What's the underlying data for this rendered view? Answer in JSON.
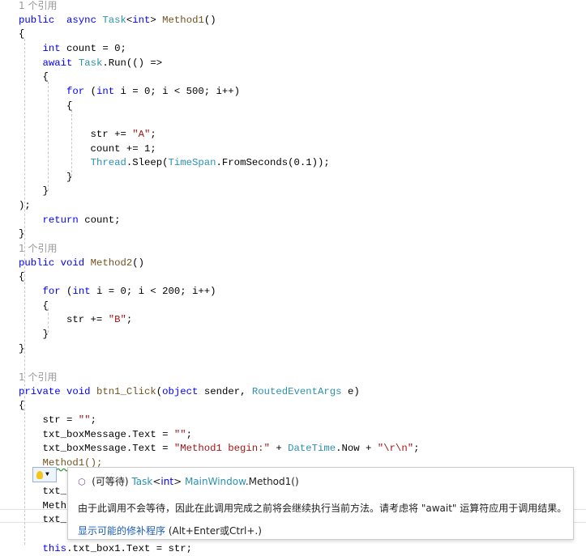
{
  "code_lines": [
    [
      [
        "1 个引用",
        "cm"
      ]
    ],
    [
      [
        "public",
        "kw"
      ],
      [
        "  ",
        ""
      ],
      [
        "async",
        "kw"
      ],
      [
        " ",
        ""
      ],
      [
        "Task",
        "ty"
      ],
      [
        "<",
        ""
      ],
      [
        "int",
        "kw"
      ],
      [
        "> ",
        ""
      ],
      [
        "Method1",
        "mt"
      ],
      [
        "()",
        ""
      ]
    ],
    [
      [
        "{",
        ""
      ]
    ],
    [
      [
        "    ",
        ""
      ],
      [
        "int",
        "kw"
      ],
      [
        " count = 0;",
        ""
      ]
    ],
    [
      [
        "    ",
        ""
      ],
      [
        "await",
        "kw"
      ],
      [
        " ",
        ""
      ],
      [
        "Task",
        "ty"
      ],
      [
        ".Run(() =>",
        ""
      ]
    ],
    [
      [
        "    {",
        ""
      ]
    ],
    [
      [
        "        ",
        ""
      ],
      [
        "for",
        "kw"
      ],
      [
        " (",
        ""
      ],
      [
        "int",
        "kw"
      ],
      [
        " i = 0; i < 500; i++)",
        ""
      ]
    ],
    [
      [
        "        {",
        ""
      ]
    ],
    [],
    [
      [
        "            str += ",
        ""
      ],
      [
        "\"A\"",
        "st"
      ],
      [
        ";",
        ""
      ]
    ],
    [
      [
        "            count += 1;",
        ""
      ]
    ],
    [
      [
        "            ",
        ""
      ],
      [
        "Thread",
        "ty"
      ],
      [
        ".Sleep(",
        ""
      ],
      [
        "TimeSpan",
        "ty"
      ],
      [
        ".FromSeconds(0.1));",
        ""
      ]
    ],
    [
      [
        "        }",
        ""
      ]
    ],
    [
      [
        "    }",
        ""
      ]
    ],
    [
      [
        ");",
        ""
      ]
    ],
    [
      [
        "    ",
        ""
      ],
      [
        "return",
        "kw"
      ],
      [
        " count;",
        ""
      ]
    ],
    [
      [
        "}",
        ""
      ]
    ],
    [
      [
        "1 个引用",
        "cm"
      ]
    ],
    [
      [
        "public",
        "kw"
      ],
      [
        " ",
        ""
      ],
      [
        "void",
        "kw"
      ],
      [
        " ",
        ""
      ],
      [
        "Method2",
        "mt"
      ],
      [
        "()",
        ""
      ]
    ],
    [
      [
        "{",
        ""
      ]
    ],
    [
      [
        "    ",
        ""
      ],
      [
        "for",
        "kw"
      ],
      [
        " (",
        ""
      ],
      [
        "int",
        "kw"
      ],
      [
        " i = 0; i < 200; i++)",
        ""
      ]
    ],
    [
      [
        "    {",
        ""
      ]
    ],
    [
      [
        "        str += ",
        ""
      ],
      [
        "\"B\"",
        "st"
      ],
      [
        ";",
        ""
      ]
    ],
    [
      [
        "    }",
        ""
      ]
    ],
    [
      [
        "}",
        ""
      ]
    ],
    [],
    [
      [
        "1 个引用",
        "cm"
      ]
    ],
    [
      [
        "private",
        "kw"
      ],
      [
        " ",
        ""
      ],
      [
        "void",
        "kw"
      ],
      [
        " ",
        ""
      ],
      [
        "btn1_Click",
        "mt"
      ],
      [
        "(",
        ""
      ],
      [
        "object",
        "kw"
      ],
      [
        " sender, ",
        ""
      ],
      [
        "RoutedEventArgs",
        "ty"
      ],
      [
        " e)",
        ""
      ]
    ],
    [
      [
        "{",
        ""
      ]
    ],
    [
      [
        "    str = ",
        ""
      ],
      [
        "\"\"",
        "st"
      ],
      [
        ";",
        ""
      ]
    ],
    [
      [
        "    txt_boxMessage.Text = ",
        ""
      ],
      [
        "\"\"",
        "st"
      ],
      [
        ";",
        ""
      ]
    ],
    [
      [
        "    txt_boxMessage.Text = ",
        ""
      ],
      [
        "\"Method1 begin:\"",
        "st"
      ],
      [
        " + ",
        ""
      ],
      [
        "DateTime",
        "ty"
      ],
      [
        ".Now + ",
        ""
      ],
      [
        "\"\\r\\n\"",
        "st"
      ],
      [
        ";",
        ""
      ]
    ],
    [
      [
        "    ",
        ""
      ],
      [
        "Method1();",
        "mt squig"
      ]
    ],
    [
      [
        "    ",
        ""
      ],
      [
        "}",
        ""
      ]
    ],
    [
      [
        "    txt_",
        ""
      ]
    ],
    [
      [
        "    Meth",
        ""
      ]
    ],
    [
      [
        "    txt_",
        ""
      ]
    ],
    [],
    [
      [
        "    ",
        ""
      ],
      [
        "this",
        "kw"
      ],
      [
        ".txt_box1.Text = str;",
        ""
      ]
    ]
  ],
  "quick_actions": {
    "icon": "lightbulb-icon",
    "dropdown_icon": "chevron-down-icon"
  },
  "tooltip": {
    "icon": "method-cube-icon",
    "prefix": "(可等待) ",
    "type": "Task",
    "lt": "<",
    "type_arg": "int",
    "gt": ">",
    "class_name": "MainWindow",
    "method": ".Method1()",
    "message": "由于此调用不会等待，因此在此调用完成之前将会继续执行当前方法。请考虑将 \"await\" 运算符应用于调用结果。",
    "fix_link": "显示可能的修补程序",
    "fix_shortcut": " (Alt+Enter或Ctrl+.)"
  },
  "colors": {
    "keyword": "#0000ff",
    "type": "#2b91af",
    "string": "#a31515",
    "method": "#74531f",
    "codelens": "#999999",
    "link": "#1a5cb8"
  }
}
